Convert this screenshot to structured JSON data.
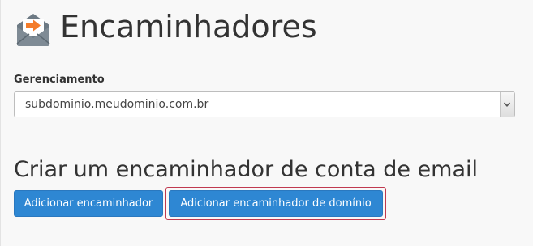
{
  "header": {
    "title": "Encaminhadores",
    "icon": "email-forwarder-icon"
  },
  "management": {
    "label": "Gerenciamento",
    "selected_domain": "subdominio.meudominio.com.br"
  },
  "create_section": {
    "title": "Criar um encaminhador de conta de email",
    "add_forwarder_label": "Adicionar encaminhador",
    "add_domain_forwarder_label": "Adicionar encaminhador de domínio"
  },
  "colors": {
    "button": "#2e87d3",
    "icon_arrow": "#f47c2a",
    "highlight_border": "#c0394f"
  }
}
